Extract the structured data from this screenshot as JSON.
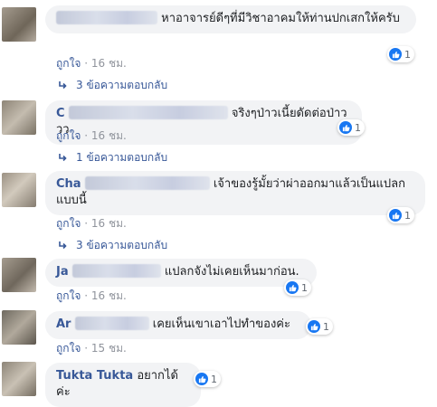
{
  "comments": [
    {
      "author_visible": "",
      "text": "หาอาจารย์ดีๆที่มีวิชาอาคมให้ท่านปกเสกให้ครับ",
      "like_label": "ถูกใจ",
      "time": "16 ชม.",
      "reaction_count": "1",
      "replies_label": "3 ข้อความตอบกลับ"
    },
    {
      "author_visible": "C",
      "text": "จริงๆป่าวเนี้ยดัดต่อป่าววว",
      "like_label": "ถูกใจ",
      "time": "16 ชม.",
      "reaction_count": "1",
      "replies_label": "1 ข้อความตอบกลับ"
    },
    {
      "author_visible": "Cha",
      "text": "เจ้าของรู้มั้ยว่าผ่าออกมาแล้วเป็นแปลกแบบนี้",
      "like_label": "ถูกใจ",
      "time": "16 ชม.",
      "reaction_count": "1",
      "replies_label": "3 ข้อความตอบกลับ"
    },
    {
      "author_visible": "Ja",
      "text": "แปลกจังไม่เคยเห็นมาก่อน.",
      "like_label": "ถูกใจ",
      "time": "16 ชม.",
      "reaction_count": "1"
    },
    {
      "author_visible": "Ar",
      "text": "เคยเห็นเขาเอาไปทำของค่ะ",
      "like_label": "ถูกใจ",
      "time": "15 ชม.",
      "reaction_count": "1"
    },
    {
      "author_visible": "Tukta Tukta",
      "text": "อยากได้ค่ะ",
      "reaction_count": "1"
    }
  ],
  "colors": {
    "link": "#385898",
    "bubble": "#f2f3f5",
    "like_blue": "#1877f2",
    "meta_gray": "#90949c"
  }
}
